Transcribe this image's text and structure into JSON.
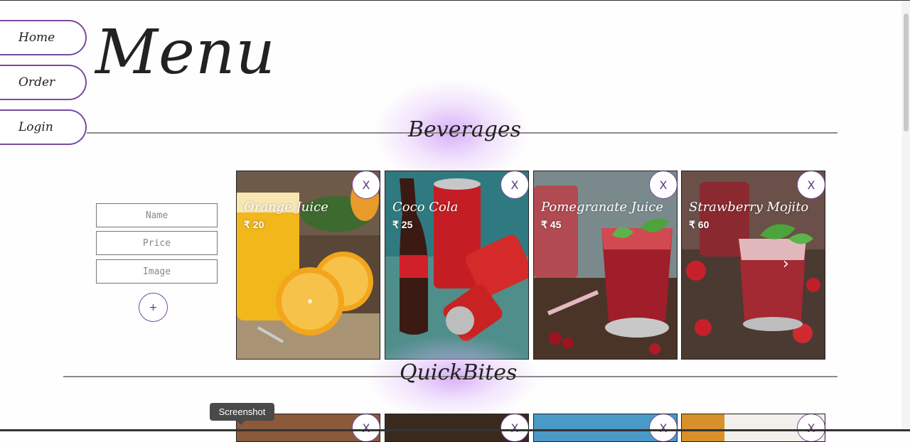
{
  "nav": {
    "items": [
      "Home",
      "Order",
      "Login"
    ]
  },
  "page": {
    "title": "Menu"
  },
  "sections": {
    "beverages": "Beverages",
    "quickbites": "QuickBites"
  },
  "form": {
    "name_placeholder": "Name",
    "price_placeholder": "Price",
    "image_placeholder": "Image",
    "add_label": "+"
  },
  "beverages": [
    {
      "name": "Orange Juice",
      "price": "₹ 20"
    },
    {
      "name": "Coco Cola",
      "price": "₹ 25"
    },
    {
      "name": "Pomegranate Juice",
      "price": "₹ 45"
    },
    {
      "name": "Strawberry Mojito",
      "price": "₹ 60"
    }
  ],
  "card": {
    "close_label": "X",
    "next_label": "›"
  },
  "tooltip": {
    "text": "Screenshot"
  },
  "colors": {
    "accent": "#7a4aa0",
    "glow": "#cc96f5"
  }
}
